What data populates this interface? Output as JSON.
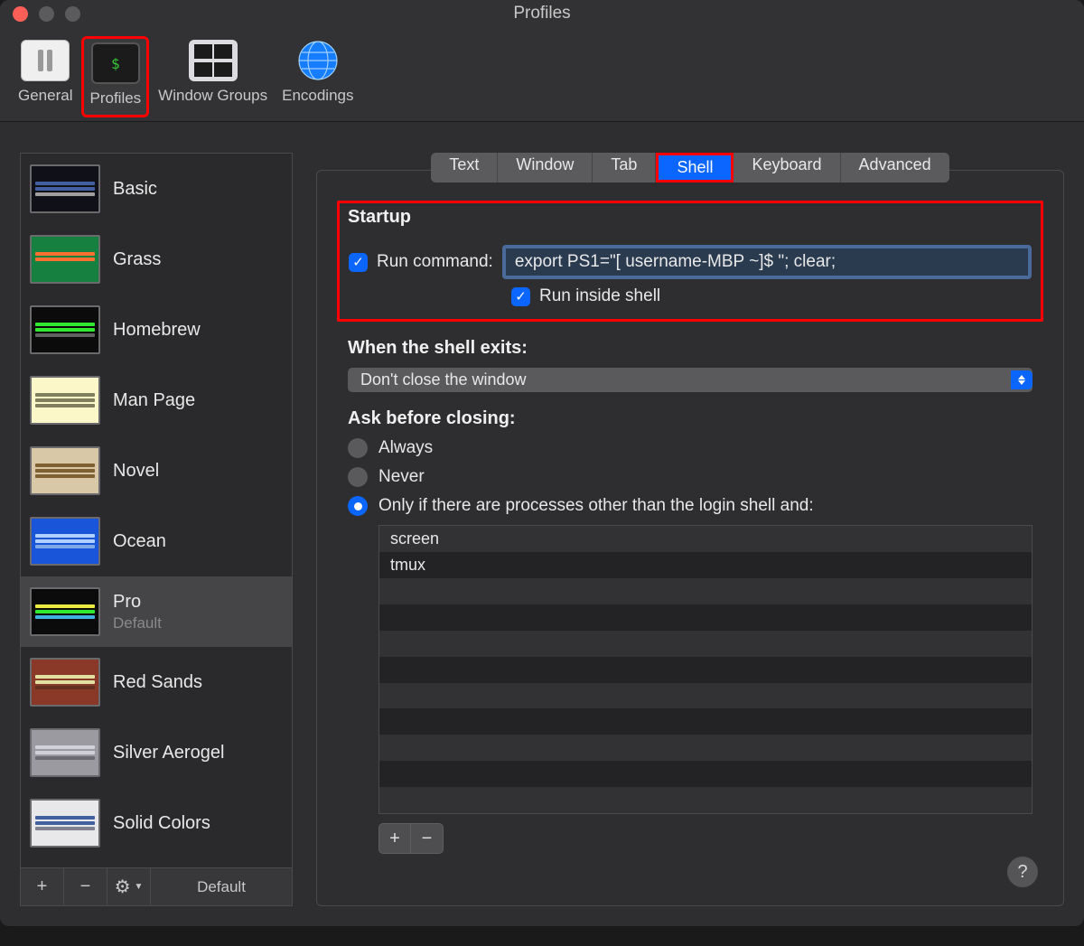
{
  "window_title": "Profiles",
  "toolbar": {
    "items": [
      {
        "id": "general",
        "label": "General"
      },
      {
        "id": "profiles",
        "label": "Profiles"
      },
      {
        "id": "window-groups",
        "label": "Window Groups"
      },
      {
        "id": "encodings",
        "label": "Encodings"
      }
    ],
    "selected": "profiles"
  },
  "profiles": [
    {
      "name": "Basic",
      "bg": "#101018",
      "lines": [
        "#4060a0",
        "#4060a0",
        "#a0a0a0"
      ]
    },
    {
      "name": "Grass",
      "bg": "#158040",
      "lines": [
        "#ff7030",
        "#ff7030",
        "#158040"
      ]
    },
    {
      "name": "Homebrew",
      "bg": "#0b0b0b",
      "lines": [
        "#30e830",
        "#30e830",
        "#606060"
      ]
    },
    {
      "name": "Man Page",
      "bg": "#fbf7c8",
      "lines": [
        "#808060",
        "#808060",
        "#808060"
      ]
    },
    {
      "name": "Novel",
      "bg": "#d8c8a8",
      "lines": [
        "#806030",
        "#806030",
        "#806030"
      ]
    },
    {
      "name": "Ocean",
      "bg": "#1855d8",
      "lines": [
        "#b0d0ff",
        "#b0d0ff",
        "#80a8e8"
      ]
    },
    {
      "name": "Pro",
      "sub": "Default",
      "selected": true,
      "bg": "#0b0b0b",
      "lines": [
        "#eaea40",
        "#30e830",
        "#40b0e0"
      ]
    },
    {
      "name": "Red Sands",
      "bg": "#8a3828",
      "lines": [
        "#e0e0a0",
        "#e0e0a0",
        "#603020"
      ]
    },
    {
      "name": "Silver Aerogel",
      "bg": "#9a9aa0",
      "lines": [
        "#d0d0d8",
        "#d0d0d8",
        "#6a6a70"
      ]
    },
    {
      "name": "Solid Colors",
      "bg": "#e8e8ea",
      "lines": [
        "#4060a0",
        "#4060a0",
        "#808090"
      ]
    }
  ],
  "sidebar_footer": {
    "add": "+",
    "remove": "−",
    "gear": "⚙︎",
    "default_label": "Default"
  },
  "tabs": [
    "Text",
    "Window",
    "Tab",
    "Shell",
    "Keyboard",
    "Advanced"
  ],
  "active_tab": "Shell",
  "startup": {
    "title": "Startup",
    "run_command_checked": true,
    "run_command_label": "Run command:",
    "command_value": "export PS1=\"[ username-MBP ~]$ \"; clear;",
    "run_inside_shell_checked": true,
    "run_inside_shell_label": "Run inside shell"
  },
  "shell_exit": {
    "label": "When the shell exits:",
    "value": "Don't close the window"
  },
  "ask_before_closing": {
    "label": "Ask before closing:",
    "options": [
      {
        "label": "Always",
        "selected": false
      },
      {
        "label": "Never",
        "selected": false
      },
      {
        "label": "Only if there are processes other than the login shell and:",
        "selected": true
      }
    ],
    "processes": [
      "screen",
      "tmux"
    ]
  },
  "table_buttons": {
    "add": "+",
    "remove": "−"
  },
  "help": "?"
}
